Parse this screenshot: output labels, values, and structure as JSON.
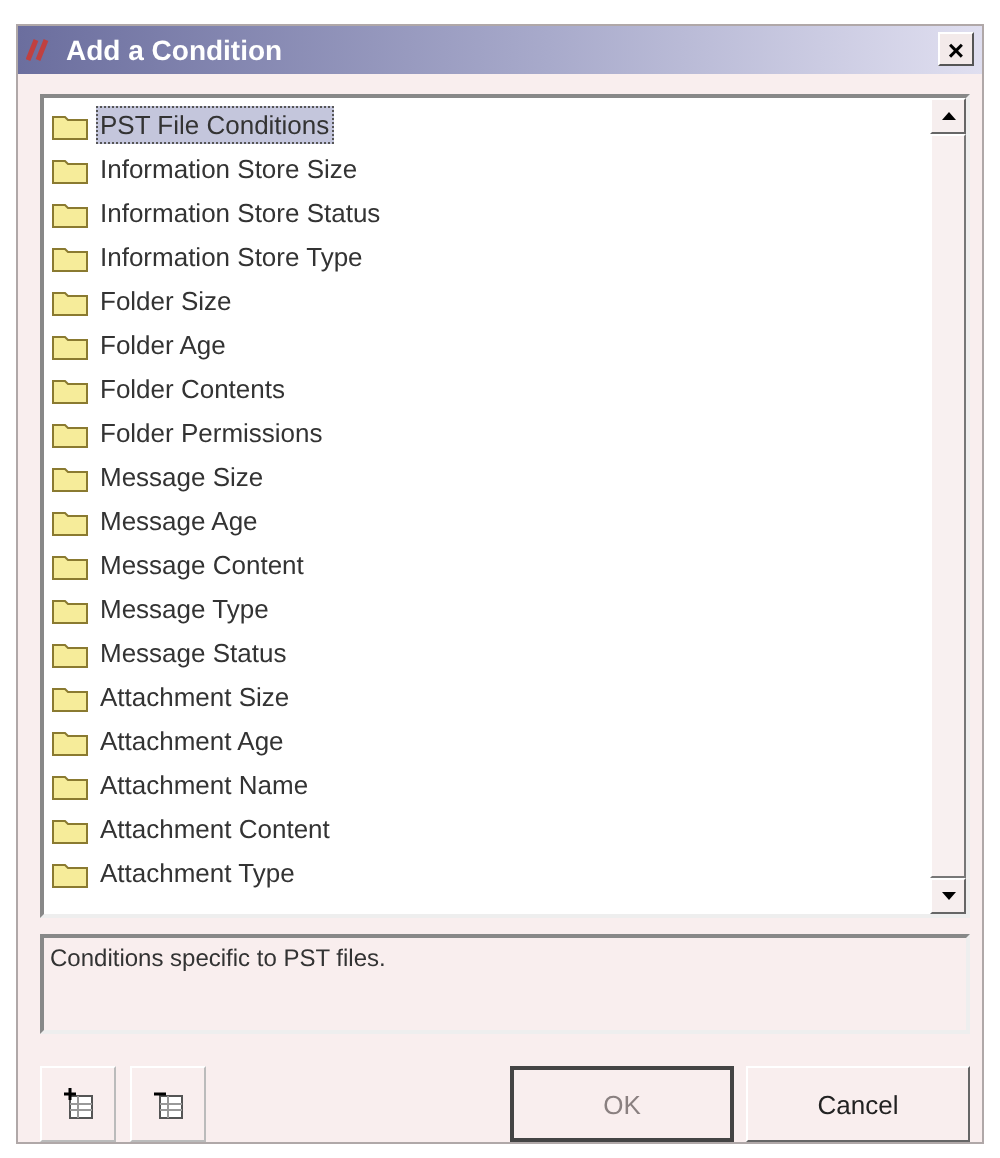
{
  "window": {
    "title": "Add a Condition",
    "close": "×"
  },
  "conditions": [
    {
      "label": "PST File Conditions",
      "selected": true
    },
    {
      "label": "Information Store Size",
      "selected": false
    },
    {
      "label": "Information Store Status",
      "selected": false
    },
    {
      "label": "Information Store Type",
      "selected": false
    },
    {
      "label": "Folder Size",
      "selected": false
    },
    {
      "label": "Folder Age",
      "selected": false
    },
    {
      "label": "Folder Contents",
      "selected": false
    },
    {
      "label": "Folder Permissions",
      "selected": false
    },
    {
      "label": "Message Size",
      "selected": false
    },
    {
      "label": "Message Age",
      "selected": false
    },
    {
      "label": "Message Content",
      "selected": false
    },
    {
      "label": "Message Type",
      "selected": false
    },
    {
      "label": "Message Status",
      "selected": false
    },
    {
      "label": "Attachment Size",
      "selected": false
    },
    {
      "label": "Attachment Age",
      "selected": false
    },
    {
      "label": "Attachment Name",
      "selected": false
    },
    {
      "label": "Attachment Content",
      "selected": false
    },
    {
      "label": "Attachment Type",
      "selected": false
    }
  ],
  "description": "Conditions specific to PST files.",
  "buttons": [
    {
      "label": "OK",
      "disabled": true
    },
    {
      "label": "Cancel",
      "disabled": false
    }
  ]
}
